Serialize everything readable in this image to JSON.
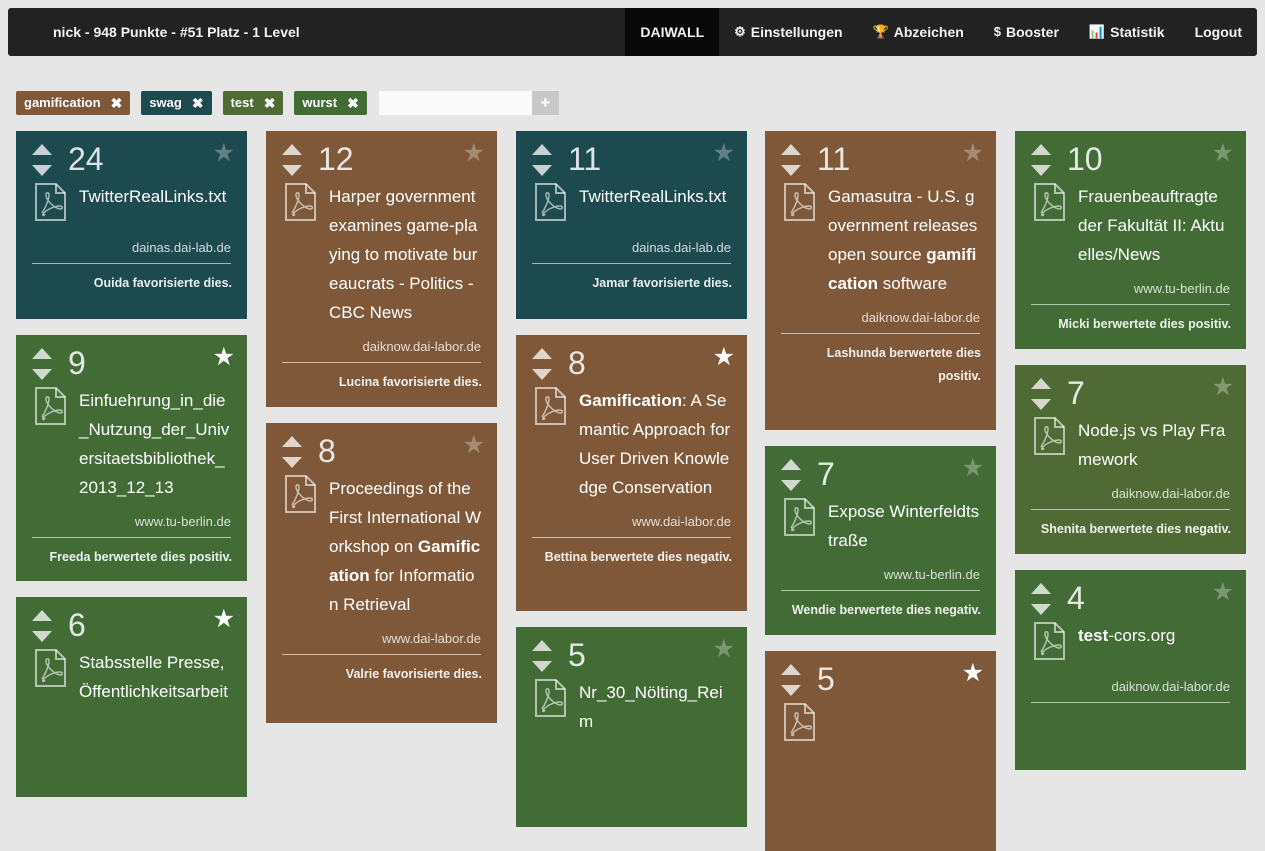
{
  "navbar": {
    "brand": "nick - 948 Punkte - #51 Platz - 1 Level",
    "items": [
      {
        "label": "DAIWALL",
        "icon": "",
        "icon_name": "",
        "active": true
      },
      {
        "label": "Einstellungen",
        "icon": "⚙",
        "icon_name": "cogs-icon",
        "active": false
      },
      {
        "label": "Abzeichen",
        "icon": "🏆",
        "icon_name": "trophy-icon",
        "active": false
      },
      {
        "label": "Booster",
        "icon": "$",
        "icon_name": "dollar-icon",
        "active": false
      },
      {
        "label": "Statistik",
        "icon": "📊",
        "icon_name": "bar-chart-icon",
        "active": false
      },
      {
        "label": "Logout",
        "icon": "",
        "icon_name": "",
        "active": false
      }
    ]
  },
  "tags": [
    {
      "label": "gamification",
      "color": "#7e5838",
      "remove": "✖"
    },
    {
      "label": "swag",
      "color": "#1d4a4f",
      "remove": "✖"
    },
    {
      "label": "test",
      "color": "#4f6a34",
      "remove": "✖"
    },
    {
      "label": "wurst",
      "color": "#426b36",
      "remove": "✖"
    }
  ],
  "tag_input": {
    "value": "",
    "placeholder": "",
    "add": "+"
  },
  "colors": {
    "teal": "#1d4a4f",
    "brown": "#7e5838",
    "green": "#426b36",
    "olive": "#4f6a34"
  },
  "columns": [
    [
      {
        "score": "24",
        "starred": false,
        "color": "teal",
        "title": [
          {
            "t": "TwitterRealLinks.txt",
            "b": false
          }
        ],
        "source": "dainas.dai-lab.de",
        "activity": "Ouida favorisierte dies."
      },
      {
        "score": "9",
        "starred": true,
        "color": "green",
        "title": [
          {
            "t": "Einfuehrung_in_die_Nutzung_der_Universitaetsbibliothek_2013_12_13",
            "b": false
          }
        ],
        "source": "www.tu-berlin.de",
        "activity": "Freeda berwertete dies positiv."
      },
      {
        "score": "6",
        "starred": true,
        "color": "green",
        "title": [
          {
            "t": "Stabsstelle Presse, Öffentlichkeitsarbeit",
            "b": false
          }
        ],
        "source": "",
        "activity": ""
      }
    ],
    [
      {
        "score": "12",
        "starred": false,
        "color": "brown",
        "title": [
          {
            "t": "Harper government examines game-playing to motivate bureaucrats - Politics - CBC News",
            "b": false
          }
        ],
        "source": "daiknow.dai-labor.de",
        "activity": "Lucina favorisierte dies."
      },
      {
        "score": "8",
        "starred": false,
        "color": "brown",
        "title": [
          {
            "t": "Proceedings of the First International Workshop on ",
            "b": false
          },
          {
            "t": "Gamification",
            "b": true
          },
          {
            "t": " for Information Retrieval",
            "b": false
          }
        ],
        "source": "www.dai-labor.de",
        "activity": "Valrie favorisierte dies."
      }
    ],
    [
      {
        "score": "11",
        "starred": false,
        "color": "teal",
        "title": [
          {
            "t": "TwitterRealLinks.txt",
            "b": false
          }
        ],
        "source": "dainas.dai-lab.de",
        "activity": "Jamar favorisierte dies."
      },
      {
        "score": "8",
        "starred": true,
        "color": "brown",
        "title": [
          {
            "t": "Gamification",
            "b": true
          },
          {
            "t": ": A Semantic Approach for User Driven Knowledge Conservation",
            "b": false
          }
        ],
        "source": "www.dai-labor.de",
        "activity": "Bettina berwertete dies negativ."
      },
      {
        "score": "5",
        "starred": false,
        "color": "green",
        "title": [
          {
            "t": "Nr_30_Nölting_Reim",
            "b": false
          }
        ],
        "source": "",
        "activity": ""
      }
    ],
    [
      {
        "score": "11",
        "starred": false,
        "color": "brown",
        "title": [
          {
            "t": "Gamasutra - U.S. government releases open source ",
            "b": false
          },
          {
            "t": "gamification",
            "b": true
          },
          {
            "t": " software",
            "b": false
          }
        ],
        "source": "daiknow.dai-labor.de",
        "activity": "Lashunda berwertete dies positiv."
      },
      {
        "score": "7",
        "starred": false,
        "color": "green",
        "title": [
          {
            "t": "Expose Winterfeldtstraße",
            "b": false
          }
        ],
        "source": "www.tu-berlin.de",
        "activity": "Wendie berwertete dies negativ."
      },
      {
        "score": "5",
        "starred": true,
        "color": "brown",
        "title": [],
        "source": "",
        "activity": ""
      }
    ],
    [
      {
        "score": "10",
        "starred": false,
        "color": "green",
        "title": [
          {
            "t": "Frauenbeauftragte der Fakultät II: Aktuelles/News",
            "b": false
          }
        ],
        "source": "www.tu-berlin.de",
        "activity": "Micki berwertete dies positiv."
      },
      {
        "score": "7",
        "starred": false,
        "color": "olive",
        "title": [
          {
            "t": "Node.js vs Play Framework",
            "b": false
          }
        ],
        "source": "daiknow.dai-labor.de",
        "activity": "Shenita berwertete dies negativ."
      },
      {
        "score": "4",
        "starred": false,
        "color": "green",
        "title": [
          {
            "t": "test",
            "b": true
          },
          {
            "t": "-cors.org",
            "b": false
          }
        ],
        "source": "daiknow.dai-labor.de",
        "activity": ""
      }
    ]
  ]
}
